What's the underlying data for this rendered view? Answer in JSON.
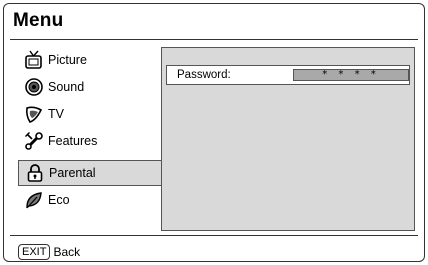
{
  "header": {
    "title": "Menu"
  },
  "menu": {
    "items": [
      {
        "label": "Picture",
        "icon": "tv-icon"
      },
      {
        "label": "Sound",
        "icon": "speaker-icon"
      },
      {
        "label": "TV",
        "icon": "satellite-dish-icon"
      },
      {
        "label": "Features",
        "icon": "wrench-icon"
      },
      {
        "label": "Parental",
        "icon": "padlock-icon",
        "selected": true
      },
      {
        "label": "Eco",
        "icon": "leaf-icon"
      }
    ]
  },
  "panel": {
    "password_label": "Password:",
    "password_value": "* * * *"
  },
  "footer": {
    "key_label": "EXIT",
    "action_label": "Back"
  },
  "colors": {
    "panel_bg": "#d9d9d9",
    "field_bg": "#a9a9a9",
    "border": "#555555"
  }
}
